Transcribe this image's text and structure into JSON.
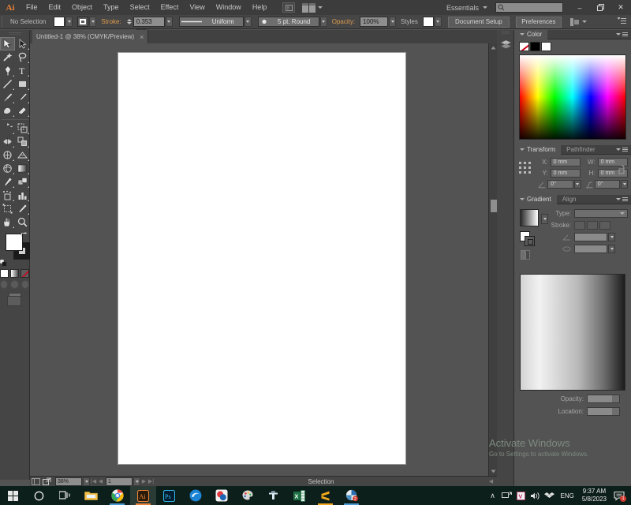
{
  "app": {
    "name": "Adobe Illustrator",
    "logo_text": "Ai",
    "workspace": "Essentials",
    "search_placeholder": ""
  },
  "menubar": {
    "items": [
      {
        "label": "File"
      },
      {
        "label": "Edit"
      },
      {
        "label": "Object"
      },
      {
        "label": "Type"
      },
      {
        "label": "Select"
      },
      {
        "label": "Effect"
      },
      {
        "label": "View"
      },
      {
        "label": "Window"
      },
      {
        "label": "Help"
      }
    ],
    "window_buttons": {
      "minimize": "–",
      "restore": "❐",
      "close": "✕"
    }
  },
  "controlbar": {
    "selection_status": "No Selection",
    "fill_color": "#ffffff",
    "stroke_color": "#ffffff",
    "stroke_label": "Stroke:",
    "stroke_weight": "0.353 mm",
    "stroke_profile": "Uniform",
    "brush_definition": "5 pt. Round",
    "opacity_label": "Opacity:",
    "opacity_value": "100%",
    "styles_label": "Styles",
    "document_setup": "Document Setup",
    "preferences": "Preferences"
  },
  "tabs": [
    {
      "title": "Untitled-1 @ 38% (CMYK/Preview)",
      "close": "×",
      "active": true
    }
  ],
  "tools": [
    {
      "name": "selection-tool",
      "label": "Selection",
      "active": true
    },
    {
      "name": "direct-selection-tool",
      "label": "Direct Selection"
    },
    {
      "name": "magic-wand-tool",
      "label": "Magic Wand"
    },
    {
      "name": "lasso-tool",
      "label": "Lasso"
    },
    {
      "name": "pen-tool",
      "label": "Pen"
    },
    {
      "name": "type-tool",
      "label": "Type"
    },
    {
      "name": "line-segment-tool",
      "label": "Line Segment"
    },
    {
      "name": "rectangle-tool",
      "label": "Rectangle"
    },
    {
      "name": "paintbrush-tool",
      "label": "Paintbrush"
    },
    {
      "name": "pencil-tool",
      "label": "Pencil"
    },
    {
      "name": "blob-brush-tool",
      "label": "Blob Brush"
    },
    {
      "name": "eraser-tool",
      "label": "Eraser"
    },
    {
      "name": "rotate-tool",
      "label": "Rotate"
    },
    {
      "name": "scale-tool",
      "label": "Scale"
    },
    {
      "name": "width-tool",
      "label": "Width"
    },
    {
      "name": "shape-builder-tool",
      "label": "Shape Builder"
    },
    {
      "name": "free-transform-tool",
      "label": "Free Transform"
    },
    {
      "name": "perspective-grid-tool",
      "label": "Perspective Grid"
    },
    {
      "name": "mesh-tool",
      "label": "Mesh"
    },
    {
      "name": "gradient-tool",
      "label": "Gradient"
    },
    {
      "name": "eyedropper-tool",
      "label": "Eyedropper"
    },
    {
      "name": "blend-tool",
      "label": "Blend"
    },
    {
      "name": "symbol-sprayer-tool",
      "label": "Symbol Sprayer"
    },
    {
      "name": "column-graph-tool",
      "label": "Column Graph"
    },
    {
      "name": "artboard-tool",
      "label": "Artboard"
    },
    {
      "name": "slice-tool",
      "label": "Slice"
    },
    {
      "name": "hand-tool",
      "label": "Hand"
    },
    {
      "name": "zoom-tool",
      "label": "Zoom"
    }
  ],
  "panels": {
    "color": {
      "title": "Color",
      "swatches": [
        {
          "name": "none-swatch",
          "color": "#ffffff"
        },
        {
          "name": "black-swatch",
          "color": "#000000"
        },
        {
          "name": "white-swatch",
          "color": "#ffffff"
        }
      ]
    },
    "transform": {
      "title": "Transform",
      "sibling_tab": "Pathfinder",
      "x_label": "X:",
      "x_value": "0 mm",
      "w_label": "W:",
      "w_value": "0 mm",
      "y_label": "Y:",
      "y_value": "0 mm",
      "h_label": "H:",
      "h_value": "0 mm",
      "angle_value": "0°",
      "shear_value": "0°"
    },
    "gradient": {
      "title": "Gradient",
      "sibling_tab": "Align",
      "type_label": "Type:",
      "type_value": "",
      "stroke_label": "Stroke:",
      "angle_value": "",
      "aspect_value": "",
      "opacity_label": "Opacity:",
      "opacity_value": "",
      "location_label": "Location:",
      "location_value": ""
    }
  },
  "statusbar": {
    "zoom": "38%",
    "page": "1",
    "tool_status": "Selection"
  },
  "watermark": {
    "line1": "Activate Windows",
    "line2": "Go to Settings to activate Windows."
  },
  "taskbar": {
    "items": [
      {
        "name": "start-button",
        "label": "Start"
      },
      {
        "name": "cortana-search-icon",
        "label": "Search"
      },
      {
        "name": "task-view-icon",
        "label": "Task View"
      },
      {
        "name": "file-explorer-icon",
        "label": "File Explorer"
      },
      {
        "name": "google-chrome-icon",
        "label": "Google Chrome"
      },
      {
        "name": "adobe-illustrator-icon",
        "label": "Adobe Illustrator"
      },
      {
        "name": "adobe-photoshop-icon",
        "label": "Adobe Photoshop"
      },
      {
        "name": "edge-icon",
        "label": "Microsoft Edge"
      },
      {
        "name": "media-player-icon",
        "label": "Media Player"
      },
      {
        "name": "paint-icon",
        "label": "Paint"
      },
      {
        "name": "utorrent-icon",
        "label": "uTorrent"
      },
      {
        "name": "excel-icon",
        "label": "Microsoft Excel"
      },
      {
        "name": "sublime-icon",
        "label": "Sublime Text"
      },
      {
        "name": "app-icon",
        "label": "App"
      }
    ],
    "tray": {
      "chevron": "∧",
      "language": "ENG",
      "time": "9:37 AM",
      "date": "5/8/2023",
      "notification_count": "1"
    }
  }
}
